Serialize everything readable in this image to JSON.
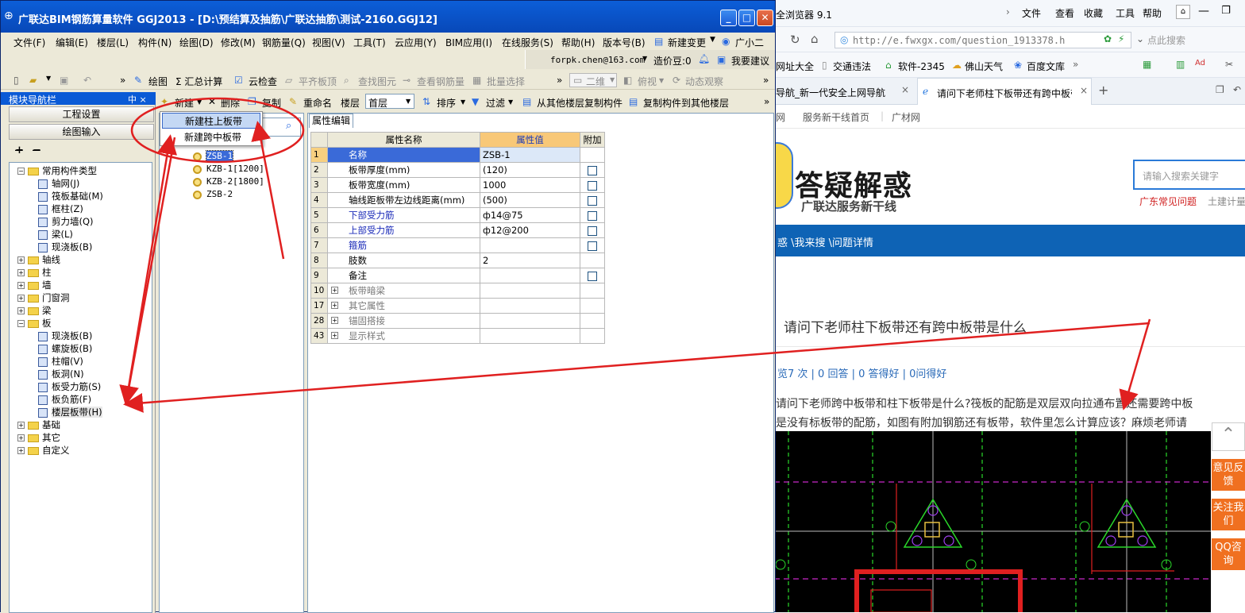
{
  "app": {
    "title": "广联达BIM钢筋算量软件 GGJ2013 - [D:\\预结算及抽筋\\广联达抽筋\\测试-2160.GGJ12]",
    "window_buttons": [
      "_",
      "□",
      "✕"
    ],
    "menu": [
      "文件(F)",
      "编辑(E)",
      "楼层(L)",
      "构件(N)",
      "绘图(D)",
      "修改(M)",
      "钢筋量(Q)",
      "视图(V)",
      "工具(T)",
      "云应用(Y)",
      "BIM应用(I)",
      "在线服务(S)",
      "帮助(H)",
      "版本号(B)",
      "新建变更",
      "广小二"
    ],
    "account": "forpk.chen@163.com",
    "cost_beans": "造价豆:0",
    "suggest": "我要建议",
    "toolbar1": {
      "draw": "绘图",
      "sum": "Σ 汇总计算",
      "cloud_check": "云检查",
      "flat_top": "平齐板顶",
      "find_element": "查找图元",
      "view_rebar": "查看钢筋量",
      "batch_select": "批量选择",
      "view_mode": "二维",
      "top_view": "俯视",
      "dynamic": "动态观察"
    },
    "nav": {
      "title": "模块导航栏",
      "pin": "中 ×",
      "btn_project": "工程设置",
      "btn_draw": "绘图输入"
    },
    "toolbar2": {
      "new": "新建",
      "delete": "删除",
      "copy": "复制",
      "rename": "重命名",
      "floor_label": "楼层",
      "floor_value": "首层",
      "sort": "排序",
      "filter": "过滤",
      "copy_from": "从其他楼层复制构件",
      "copy_to": "复制构件到其他楼层"
    },
    "popup": [
      "新建柱上板带",
      "新建跨中板带"
    ],
    "tree": [
      {
        "label": "常用构件类型",
        "type": "folder",
        "state": "−",
        "level": 0
      },
      {
        "label": "轴网(J)",
        "type": "item",
        "level": 1
      },
      {
        "label": "筏板基础(M)",
        "type": "item",
        "level": 1
      },
      {
        "label": "框柱(Z)",
        "type": "item",
        "level": 1
      },
      {
        "label": "剪力墙(Q)",
        "type": "item",
        "level": 1
      },
      {
        "label": "梁(L)",
        "type": "item",
        "level": 1
      },
      {
        "label": "现浇板(B)",
        "type": "item",
        "level": 1
      },
      {
        "label": "轴线",
        "type": "folder",
        "state": "+",
        "level": 0
      },
      {
        "label": "柱",
        "type": "folder",
        "state": "+",
        "level": 0
      },
      {
        "label": "墙",
        "type": "folder",
        "state": "+",
        "level": 0
      },
      {
        "label": "门窗洞",
        "type": "folder",
        "state": "+",
        "level": 0
      },
      {
        "label": "梁",
        "type": "folder",
        "state": "+",
        "level": 0
      },
      {
        "label": "板",
        "type": "folder",
        "state": "−",
        "level": 0
      },
      {
        "label": "现浇板(B)",
        "type": "item",
        "level": 1
      },
      {
        "label": "螺旋板(B)",
        "type": "item",
        "level": 1
      },
      {
        "label": "柱帽(V)",
        "type": "item",
        "level": 1
      },
      {
        "label": "板洞(N)",
        "type": "item",
        "level": 1
      },
      {
        "label": "板受力筋(S)",
        "type": "item",
        "level": 1
      },
      {
        "label": "板负筋(F)",
        "type": "item",
        "level": 1
      },
      {
        "label": "楼层板带(H)",
        "type": "item",
        "level": 1,
        "selected": true
      },
      {
        "label": "基础",
        "type": "folder",
        "state": "+",
        "level": 0
      },
      {
        "label": "其它",
        "type": "folder",
        "state": "+",
        "level": 0
      },
      {
        "label": "自定义",
        "type": "folder",
        "state": "+",
        "level": 0
      }
    ],
    "components": [
      "ZSB-1",
      "KZB-1[1200]",
      "KZB-2[1800]",
      "ZSB-2"
    ],
    "prop_tab": "属性编辑",
    "prop_headers": {
      "name": "属性名称",
      "value": "属性值",
      "extra": "附加"
    },
    "props": [
      {
        "no": "1",
        "name": "名称",
        "value": "ZSB-1",
        "check": false,
        "blue": true
      },
      {
        "no": "2",
        "name": "板带厚度(mm)",
        "value": "(120)",
        "check": true
      },
      {
        "no": "3",
        "name": "板带宽度(mm)",
        "value": "1000",
        "check": true
      },
      {
        "no": "4",
        "name": "轴线距板带左边线距离(mm)",
        "value": "(500)",
        "check": true
      },
      {
        "no": "5",
        "name": "下部受力筋",
        "value": "ф14@75",
        "check": true,
        "blue": true
      },
      {
        "no": "6",
        "name": "上部受力筋",
        "value": "ф12@200",
        "check": true,
        "blue": true
      },
      {
        "no": "7",
        "name": "箍筋",
        "value": "",
        "check": true,
        "blue": true
      },
      {
        "no": "8",
        "name": "肢数",
        "value": "2",
        "check": false
      },
      {
        "no": "9",
        "name": "备注",
        "value": "",
        "check": true
      },
      {
        "no": "10",
        "name": "板带暗梁",
        "value": "",
        "check": false,
        "group": true
      },
      {
        "no": "17",
        "name": "其它属性",
        "value": "",
        "check": false,
        "group": true
      },
      {
        "no": "28",
        "name": "锚固搭接",
        "value": "",
        "check": false,
        "group": true
      },
      {
        "no": "43",
        "name": "显示样式",
        "value": "",
        "check": false,
        "group": true
      }
    ]
  },
  "browser": {
    "title": "全浏览器 9.1",
    "menu": [
      "文件",
      "查看",
      "收藏",
      "工具",
      "帮助"
    ],
    "url": "http://e.fwxgx.com/question_1913378.h",
    "search_placeholder": "点此搜索",
    "favorites": [
      "网址大全",
      "交通违法",
      "软件-2345",
      "佛山天气",
      "百度文库"
    ],
    "tabs": [
      "导航_新一代安全上网导航",
      "请问下老师柱下板带还有跨中板带"
    ],
    "site_nav": [
      "服务新干线首页",
      "广材网"
    ],
    "logo_title": "答疑解惑",
    "logo_sub": "广联达服务新干线",
    "site_search_placeholder": "请输入搜索关键字",
    "hot_links": [
      "广东常见问题",
      "土建计量"
    ],
    "breadcrumb": "惑 \\我来搜 \\问题详情",
    "question_title": "请问下老师柱下板带还有跨中板带是什么",
    "stats": "览7 次 | 0 回答 | 0 答得好 | 0问得好",
    "question_body_1": "请问下老师跨中板带和柱下板带是什么?筏板的配筋是双层双向拉通布置还需要跨中板",
    "question_body_2": "是没有标板带的配筋，如图有附加钢筋还有板带，软件里怎么计算应该？麻烦老师请",
    "side_buttons": [
      "意见反馈",
      "关注我们",
      "QQ咨询"
    ]
  }
}
